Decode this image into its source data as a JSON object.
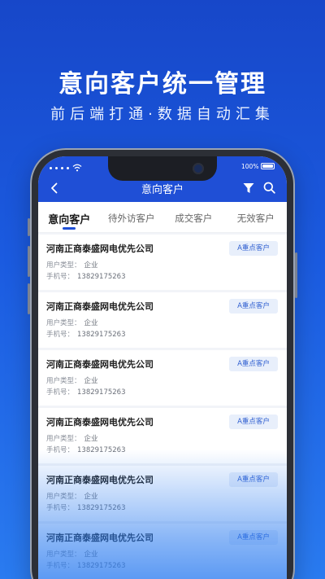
{
  "hero": {
    "title": "意向客户统一管理",
    "subtitle": "前后端打通·数据自动汇集"
  },
  "status_bar": {
    "battery": "100%"
  },
  "header": {
    "title": "意向客户"
  },
  "icons": {
    "back": "back-arrow-icon",
    "filter": "filter-icon",
    "search": "search-icon"
  },
  "tabs": [
    {
      "label": "意向客户",
      "active": true
    },
    {
      "label": "待外访客户",
      "active": false
    },
    {
      "label": "成交客户",
      "active": false
    },
    {
      "label": "无效客户",
      "active": false
    }
  ],
  "field_labels": {
    "user_type": "用户类型：",
    "phone": "手机号："
  },
  "customers": [
    {
      "name": "河南正商泰盛网电优先公司",
      "user_type": "企业",
      "phone": "13829175263",
      "tag": "A重点客户"
    },
    {
      "name": "河南正商泰盛网电优先公司",
      "user_type": "企业",
      "phone": "13829175263",
      "tag": "A重点客户"
    },
    {
      "name": "河南正商泰盛网电优先公司",
      "user_type": "企业",
      "phone": "13829175263",
      "tag": "A重点客户"
    },
    {
      "name": "河南正商泰盛网电优先公司",
      "user_type": "企业",
      "phone": "13829175263",
      "tag": "A重点客户"
    },
    {
      "name": "河南正商泰盛网电优先公司",
      "user_type": "企业",
      "phone": "13829175263",
      "tag": "A重点客户"
    },
    {
      "name": "河南正商泰盛网电优先公司",
      "user_type": "企业",
      "phone": "13829175263",
      "tag": "A重点客户"
    }
  ],
  "colors": {
    "primary": "#1f4fd6",
    "tag_bg": "#e8effb",
    "tag_text": "#2f5fd0"
  }
}
